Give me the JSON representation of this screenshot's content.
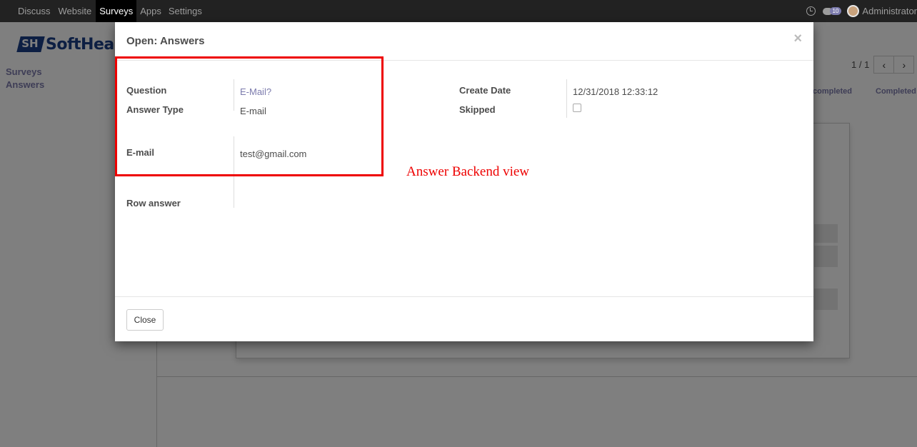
{
  "navbar": {
    "items": [
      {
        "label": "Discuss"
      },
      {
        "label": "Website"
      },
      {
        "label": "Surveys"
      },
      {
        "label": "Apps"
      },
      {
        "label": "Settings"
      }
    ],
    "active_item": "Surveys",
    "message_count": "10",
    "user_name": "Administrator"
  },
  "brand": {
    "logo_text": "SoftHea"
  },
  "sidebar": {
    "items": [
      {
        "label": "Surveys"
      },
      {
        "label": "Answers"
      }
    ]
  },
  "pager": {
    "value": "1 / 1",
    "prev": "‹",
    "next": "›"
  },
  "status_bar": {
    "items": [
      {
        "label": "completed"
      },
      {
        "label": "Completed"
      }
    ]
  },
  "modal": {
    "title": "Open: Answers",
    "close_glyph": "×",
    "fields": {
      "question_label": "Question",
      "question_value": "E-Mail?",
      "answer_type_label": "Answer Type",
      "answer_type_value": "E-mail",
      "email_label": "E-mail",
      "email_value": "test@gmail.com",
      "row_answer_label": "Row answer",
      "create_date_label": "Create Date",
      "create_date_value": "12/31/2018 12:33:12",
      "skipped_label": "Skipped",
      "skipped_checked": false
    },
    "close_button_label": "Close"
  },
  "annotation": {
    "text": "Answer Backend view",
    "color": "#e00000"
  },
  "colors": {
    "accent": "#7c7bad",
    "navbar": "#222222",
    "brand": "#1b3f87"
  }
}
